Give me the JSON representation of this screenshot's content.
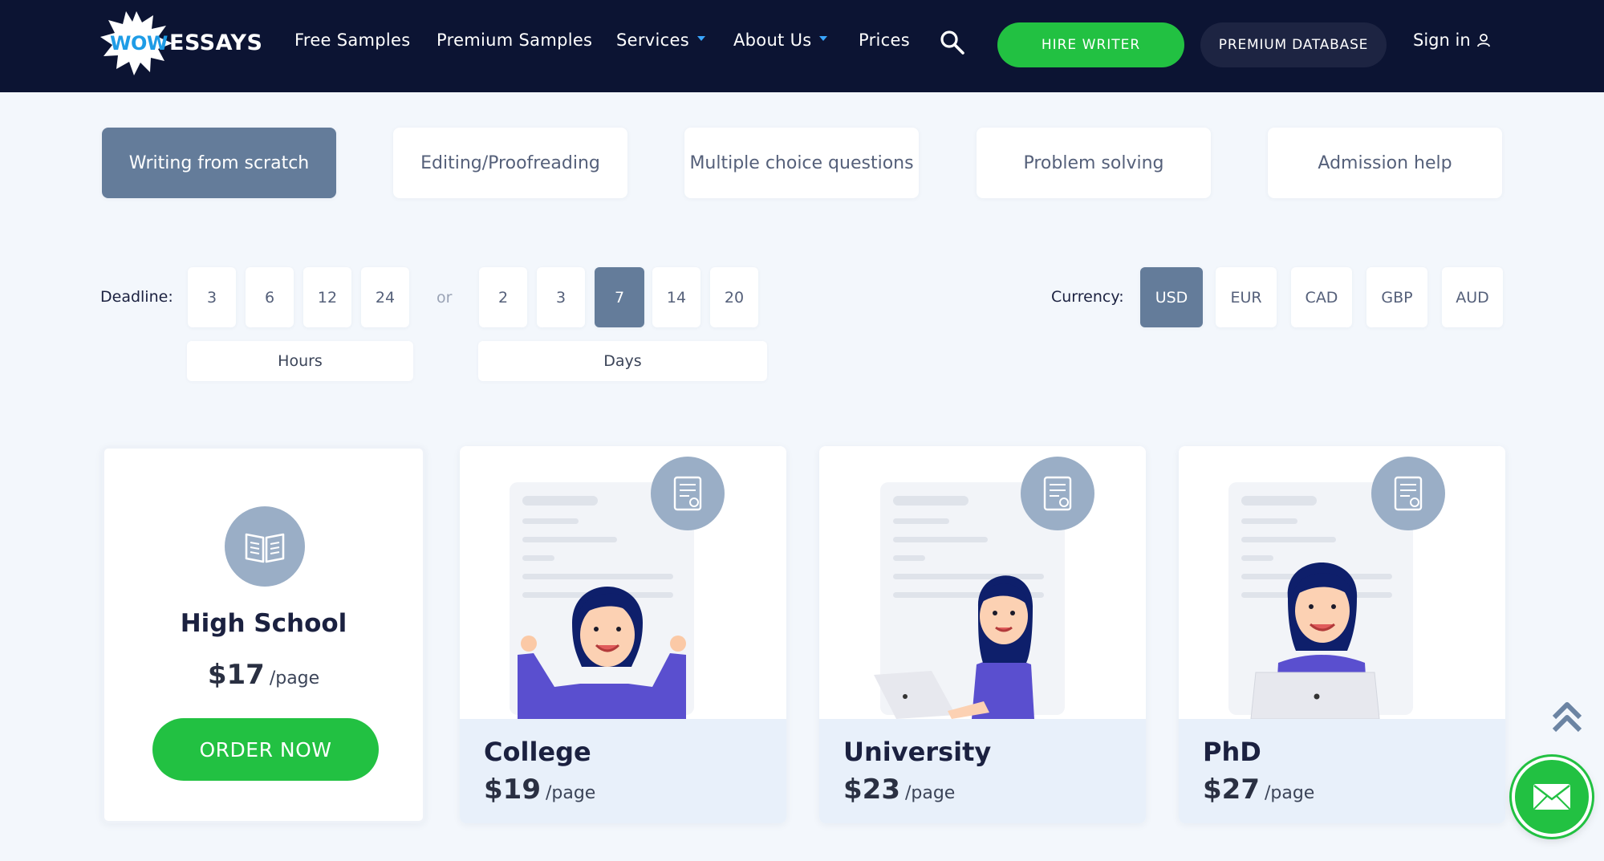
{
  "header": {
    "logo": {
      "wow": "WOW",
      "essays": "ESSAYS"
    },
    "nav": [
      {
        "label": "Free Samples"
      },
      {
        "label": "Premium Samples"
      },
      {
        "label": "Services"
      },
      {
        "label": "About Us"
      },
      {
        "label": "Prices"
      }
    ],
    "hire_label": "HIRE WRITER",
    "premium_label": "PREMIUM DATABASE",
    "signin_label": "Sign in",
    "icons": {
      "search": "search-icon",
      "user": "user-icon",
      "dropdown": "chevron-down-icon"
    },
    "colors": {
      "bg": "#0c1433",
      "accent": "#22c142",
      "caret": "#3aa6ff"
    }
  },
  "service_tabs": [
    {
      "label": "Writing from scratch",
      "active": true
    },
    {
      "label": "Editing/Proofreading",
      "active": false
    },
    {
      "label": "Multiple choice questions",
      "active": false
    },
    {
      "label": "Problem solving",
      "active": false
    },
    {
      "label": "Admission help",
      "active": false
    }
  ],
  "deadline": {
    "label": "Deadline:",
    "hours": [
      "3",
      "6",
      "12",
      "24"
    ],
    "or_label": "or",
    "days": [
      "2",
      "3",
      "7",
      "14",
      "20"
    ],
    "selected_days": "7",
    "hours_label": "Hours",
    "days_label": "Days"
  },
  "currency": {
    "label": "Currency:",
    "options": [
      "USD",
      "EUR",
      "CAD",
      "GBP",
      "AUD"
    ],
    "selected": "USD"
  },
  "levels": [
    {
      "title": "High School",
      "price": "$17",
      "unit": "/page",
      "cta": "ORDER NOW",
      "icon": "open-book-icon"
    },
    {
      "title": "College",
      "price": "$19",
      "unit": "/page",
      "icon": "certificate-icon"
    },
    {
      "title": "University",
      "price": "$23",
      "unit": "/page",
      "icon": "certificate-icon"
    },
    {
      "title": "PhD",
      "price": "$27",
      "unit": "/page",
      "icon": "certificate-icon"
    }
  ],
  "floating": {
    "scroll_top_icon": "double-chevron-up-icon",
    "mail_icon": "envelope-icon"
  },
  "colors": {
    "active_tab": "#647c9a",
    "page_bg": "#f3f7fc",
    "card_foot": "#e8f0fa",
    "green": "#22c142"
  }
}
